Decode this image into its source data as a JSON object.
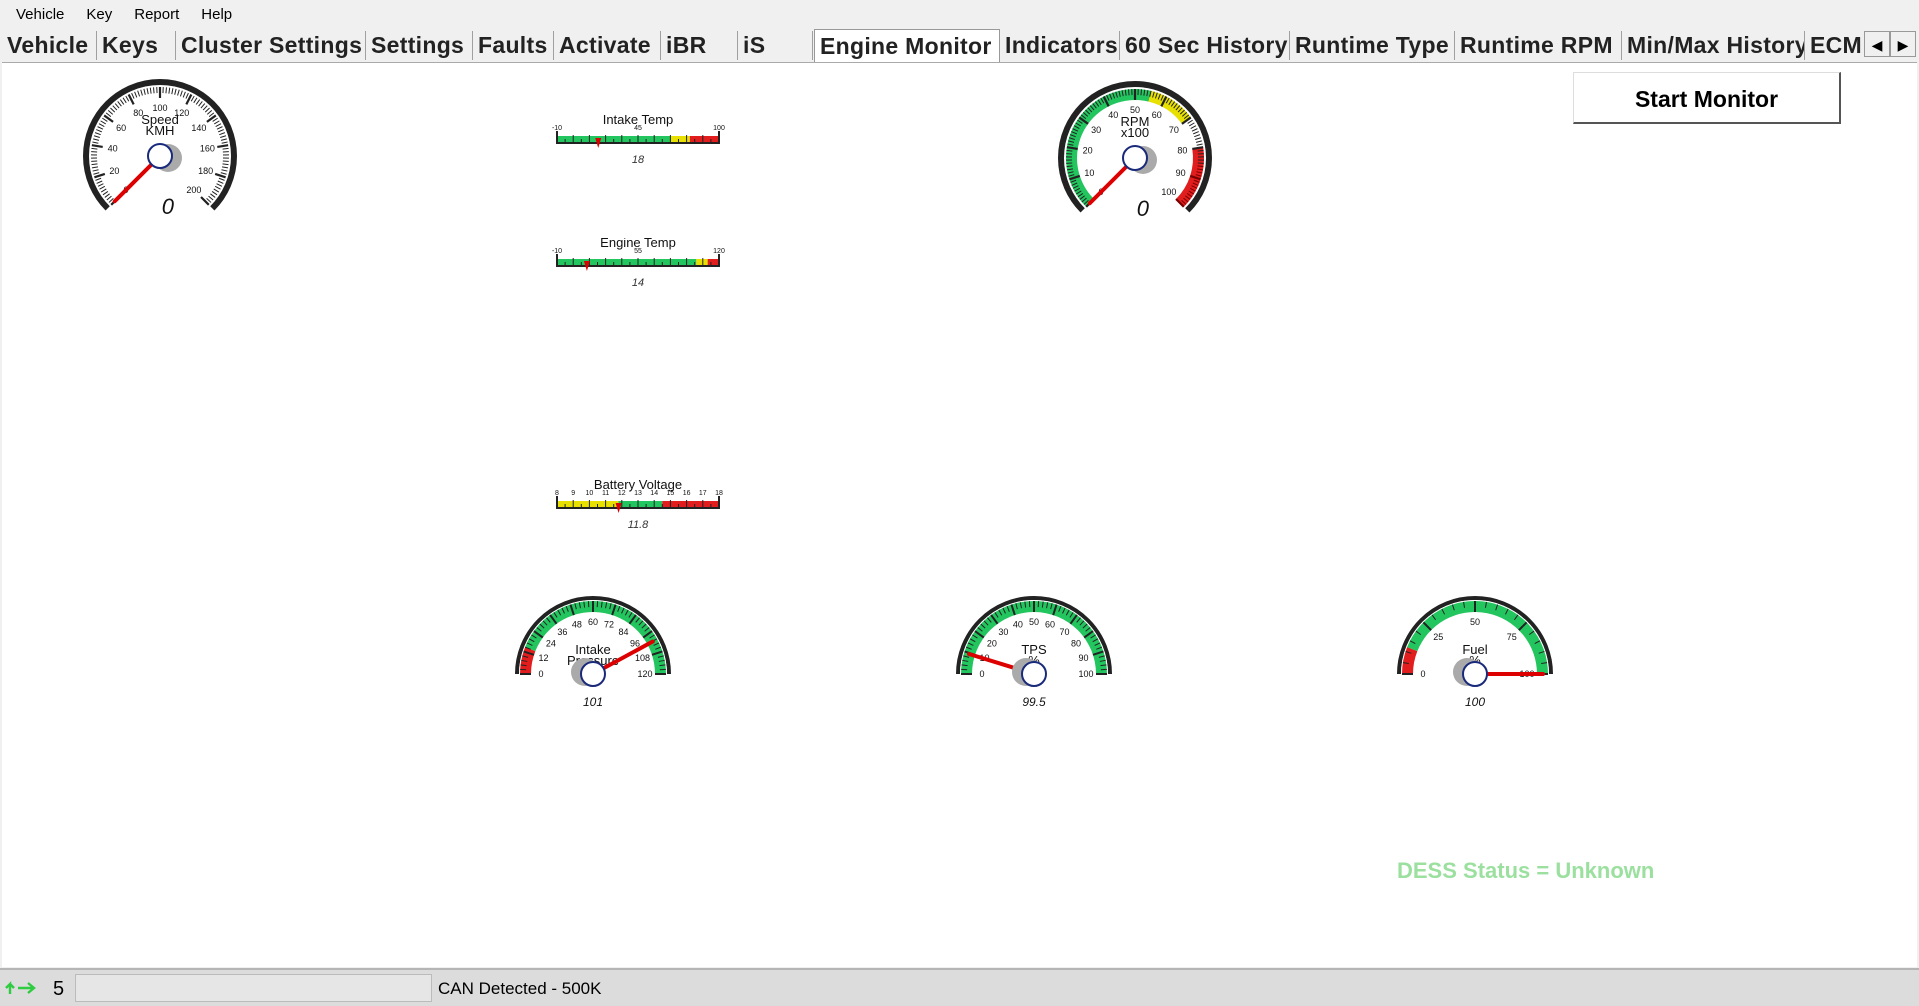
{
  "menu": [
    "Vehicle",
    "Key",
    "Report",
    "Help"
  ],
  "tabs": [
    "Vehicle",
    "Keys",
    "Cluster Settings",
    "Settings",
    "Faults",
    "Activate",
    "iBR",
    "iS",
    "Engine Monitor",
    "Indicators",
    "60 Sec History",
    "Runtime Type",
    "Runtime RPM",
    "Min/Max History",
    "ECM"
  ],
  "active_tab": "Engine Monitor",
  "start_button": "Start Monitor",
  "dess_status": "DESS Status = Unknown",
  "colors": {
    "green": "#22c55e",
    "yellow": "#e8e000",
    "red": "#e11d1d",
    "dess": "#9ce0a0"
  },
  "statusbar": {
    "count": "5",
    "can_status": "CAN Detected - 500K",
    "icon": "connection-arrows-icon"
  },
  "gauges": {
    "speed": {
      "label1": "Speed",
      "label2": "KMH",
      "ticks": [
        "0",
        "20",
        "40",
        "60",
        "80",
        "100",
        "120",
        "140",
        "160",
        "180",
        "200"
      ],
      "readout": "0",
      "value": 0
    },
    "rpm": {
      "label1": "RPM",
      "label2": "x100",
      "ticks": [
        "0",
        "10",
        "20",
        "30",
        "40",
        "50",
        "60",
        "70",
        "80",
        "90",
        "100"
      ],
      "readout": "0",
      "value": 0
    },
    "intake_temp": {
      "label": "Intake Temp",
      "ticks": [
        "-10",
        "45",
        "100"
      ],
      "readout": "18",
      "value": 18
    },
    "engine_temp": {
      "label": "Engine Temp",
      "ticks": [
        "-10",
        "55",
        "120"
      ],
      "readout": "14",
      "value": 14
    },
    "battery_voltage": {
      "label": "Battery Voltage",
      "ticks": [
        "8",
        "9",
        "10",
        "11",
        "12",
        "13",
        "14",
        "15",
        "16",
        "17",
        "18"
      ],
      "readout": "11.8",
      "value": 11.8
    },
    "intake_pressure": {
      "label1": "Intake",
      "label2": "Pressure",
      "ticks": [
        "0",
        "12",
        "24",
        "36",
        "48",
        "60",
        "72",
        "84",
        "96",
        "108",
        "120"
      ],
      "readout": "101",
      "value": 101
    },
    "tps": {
      "label1": "TPS",
      "label2": "%",
      "ticks": [
        "0",
        "10",
        "20",
        "30",
        "40",
        "50",
        "60",
        "70",
        "80",
        "90",
        "100"
      ],
      "readout": "99.5",
      "value": 9.5
    },
    "fuel": {
      "label1": "Fuel",
      "label2": "%",
      "ticks": [
        "0",
        "25",
        "50",
        "75",
        "100"
      ],
      "readout": "100",
      "value": 100
    }
  }
}
